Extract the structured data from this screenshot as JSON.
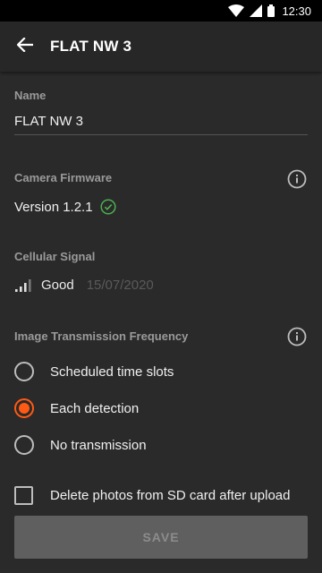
{
  "status_bar": {
    "time": "12:30",
    "icons": [
      "wifi-icon",
      "cell-signal-icon",
      "battery-icon"
    ]
  },
  "app_bar": {
    "back_icon": "arrow-left-icon",
    "title": "FLAT NW 3"
  },
  "name": {
    "label": "Name",
    "value": "FLAT NW 3"
  },
  "firmware": {
    "label": "Camera Firmware",
    "value": "Version 1.2.1",
    "status_icon": "check-circle-icon",
    "status_color": "#4caf50",
    "info_icon": "info-icon"
  },
  "signal": {
    "label": "Cellular Signal",
    "icon": "signal-bars-icon",
    "value": "Good",
    "date": "15/07/2020"
  },
  "transmission": {
    "label": "Image Transmission Frequency",
    "info_icon": "info-icon",
    "options": [
      {
        "label": "Scheduled time slots",
        "selected": false
      },
      {
        "label": "Each detection",
        "selected": true
      },
      {
        "label": "No transmission",
        "selected": false
      }
    ]
  },
  "delete_photos": {
    "label": "Delete photos from SD card after upload",
    "checked": false
  },
  "save_label": "SAVE",
  "colors": {
    "accent": "#ff5a14",
    "background": "#2a2a2a",
    "app_bar": "#272727"
  }
}
